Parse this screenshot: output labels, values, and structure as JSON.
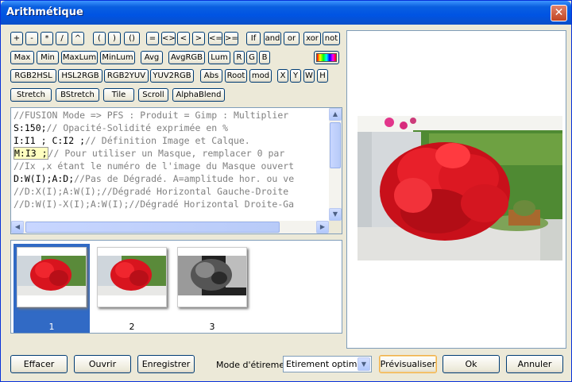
{
  "window": {
    "title": "Arithmétique",
    "close_symbol": "✕"
  },
  "operators_row1": [
    "+",
    "-",
    "*",
    "/",
    "^",
    "(",
    ")",
    "()",
    "=",
    "<>",
    "<",
    ">",
    "<=",
    ">=",
    "If",
    "and",
    "or",
    "xor",
    "not"
  ],
  "functions_row2": [
    "Max",
    "Min",
    "MaxLum",
    "MinLum",
    "Avg",
    "AvgRGB",
    "Lum",
    "R",
    "G",
    "B"
  ],
  "functions_row3": [
    "RGB2HSL",
    "HSL2RGB",
    "RGB2YUV",
    "YUV2RGB",
    "Abs",
    "Root",
    "mod",
    "X",
    "Y",
    "W",
    "H"
  ],
  "functions_row4": [
    "Stretch",
    "BStretch",
    "Tile",
    "Scroll",
    "AlphaBlend"
  ],
  "editor": {
    "lines": [
      {
        "pre": "",
        "hl": "",
        "k": "",
        "comment": "//FUSION Mode => PFS : Produit = Gimp : Multiplier"
      },
      {
        "pre": "",
        "hl": "",
        "k": "S:150;",
        "comment": "// Opacité-Solidité exprimée en %"
      },
      {
        "pre": "",
        "hl": "",
        "k": "I:I1 ; C:I2 ;",
        "comment": "// Définition Image et Calque."
      },
      {
        "pre": "",
        "hl": "M:I3 ;",
        "k": "",
        "comment": "// Pour utiliser un Masque, remplacer 0 par"
      },
      {
        "pre": "",
        "hl": "",
        "k": "",
        "comment": "//Ix ,x étant le numéro de l'image du Masque ouvert"
      },
      {
        "pre": "",
        "hl": "",
        "k": "D:W(I);A:D;",
        "comment": "//Pas de Dégradé. A=amplitude hor. ou ve"
      },
      {
        "pre": "",
        "hl": "",
        "k": "",
        "comment": "//D:X(I);A:W(I);//Dégradé Horizontal Gauche-Droite"
      },
      {
        "pre": "",
        "hl": "",
        "k": "",
        "comment": "//D:W(I)-X(I);A:W(I);//Dégradé Horizontal Droite-Ga"
      }
    ]
  },
  "thumbnails": [
    {
      "label": "1",
      "selected": true
    },
    {
      "label": "2",
      "selected": false
    },
    {
      "label": "3",
      "selected": false
    }
  ],
  "bottom": {
    "clear": "Effacer",
    "open": "Ouvrir",
    "save": "Enregistrer",
    "stretch_mode_label": "Mode d'étirement",
    "stretch_mode_value": "Etirement optimisé",
    "preview": "Prévisualiser",
    "ok": "Ok",
    "cancel": "Annuler"
  },
  "colors": {
    "title_bar": "#0054e3",
    "selection": "#316ac5",
    "face": "#ece9d8"
  }
}
